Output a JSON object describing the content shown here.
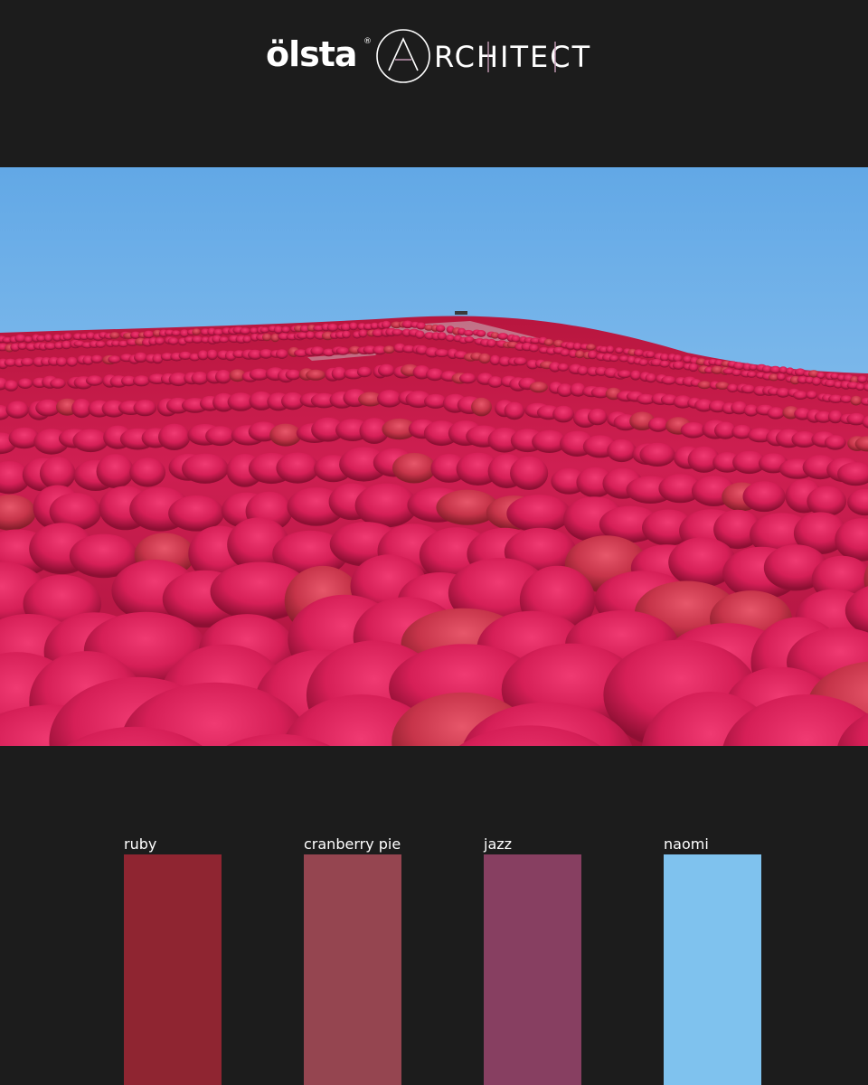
{
  "brand": {
    "name": "ölsta",
    "registered_mark": "®",
    "product": "ARCHITECT",
    "product_initial": "A",
    "product_rest": "RCHITECT"
  },
  "photo": {
    "sky_top": "#6aaee8",
    "sky_bottom": "#9ccdf2",
    "foliage": "#d7245a"
  },
  "palette": [
    {
      "name": "ruby",
      "color": "#8f2531"
    },
    {
      "name": "cranberry pie",
      "color": "#954550"
    },
    {
      "name": "jazz",
      "color": "#873f61"
    },
    {
      "name": "naomi",
      "color": "#7fc2ee"
    }
  ]
}
